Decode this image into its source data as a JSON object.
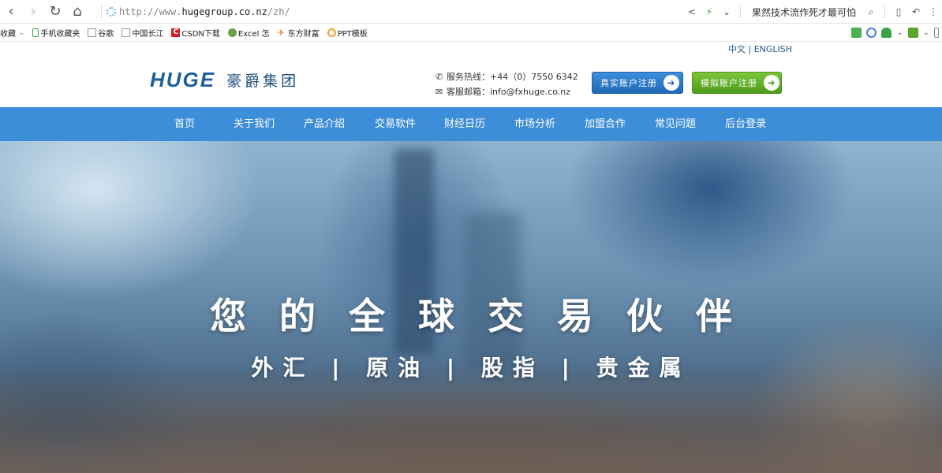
{
  "browser": {
    "url_protocol": "http://www.",
    "url_host": "hugegroup.co.nz",
    "url_path": "/zh/",
    "search_text": "果然技术流作死才最可怕",
    "back_icon": "chevron-left",
    "forward_icon": "chevron-right",
    "refresh_icon": "refresh",
    "home_icon": "home"
  },
  "bookmarks": [
    {
      "label": "收藏",
      "icon": "star",
      "color": "#888888"
    },
    {
      "label": "手机收藏夹",
      "icon": "phone",
      "color": "#3aa04a"
    },
    {
      "label": "谷歌",
      "icon": "page",
      "color": "#888888"
    },
    {
      "label": "中国长江",
      "icon": "page",
      "color": "#888888"
    },
    {
      "label": "CSDN下载",
      "icon": "csdn",
      "color": "#d0202a"
    },
    {
      "label": "Excel 怎",
      "icon": "globe",
      "color": "#4a8a3a"
    },
    {
      "label": "东方财富",
      "icon": "bird",
      "color": "#e07a20"
    },
    {
      "label": "PPT模板",
      "icon": "circle",
      "color": "#f0a020"
    }
  ],
  "header": {
    "lang": "中文 | ENGLISH",
    "logo_en": "HUGE",
    "logo_cn": "豪爵集团",
    "hotline": "服务热线：+44（0）7550 6342",
    "email": "客服邮箱：info@fxhuge.co.nz",
    "btn_real": "真实账户注册",
    "btn_demo": "模拟账户注册",
    "colors": {
      "primary": "#3d8ed8",
      "green": "#5aa628"
    }
  },
  "nav": [
    "首页",
    "关于我们",
    "产品介绍",
    "交易软件",
    "财经日历",
    "市场分析",
    "加盟合作",
    "常见问题",
    "后台登录"
  ],
  "hero": {
    "title": "您的全球交易伙伴",
    "subtitle": "外汇 | 原油 | 股指 | 贵金属"
  }
}
